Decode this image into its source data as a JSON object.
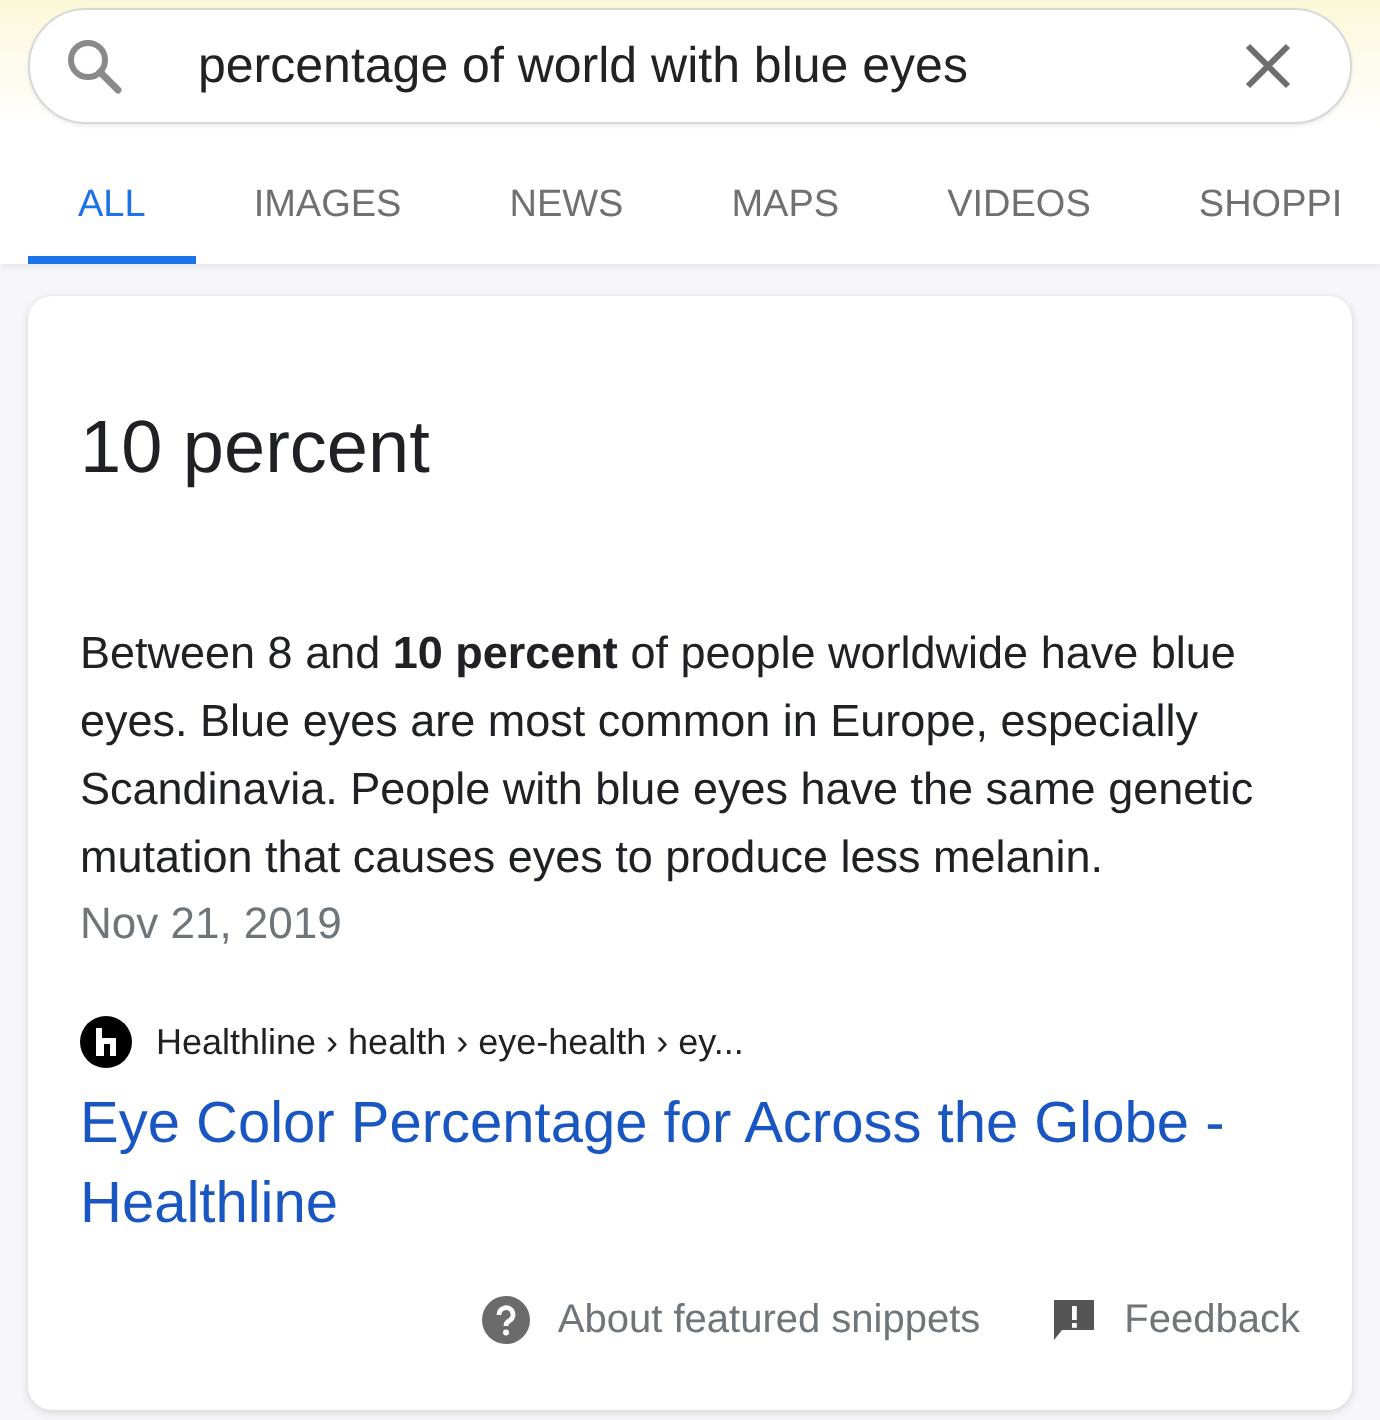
{
  "search": {
    "value": "percentage of world with blue eyes"
  },
  "tabs": [
    {
      "label": "ALL",
      "selected": true
    },
    {
      "label": "IMAGES",
      "selected": false
    },
    {
      "label": "NEWS",
      "selected": false
    },
    {
      "label": "MAPS",
      "selected": false
    },
    {
      "label": "VIDEOS",
      "selected": false
    },
    {
      "label": "SHOPPI",
      "selected": false
    }
  ],
  "snippet": {
    "answer": "10 percent",
    "text": "Between 8 and **10 percent** of people worldwide have blue eyes. Blue eyes are most common in Europe, especially Scandinavia. People with blue eyes have the same genetic mutation that causes eyes to produce less melanin.",
    "date": "Nov 21, 2019",
    "source": "Healthline › health › eye-health › ey...",
    "title": "Eye Color Percentage for Across the Globe - Healthline"
  },
  "footer": [
    "About featured snippets",
    "Feedback"
  ]
}
